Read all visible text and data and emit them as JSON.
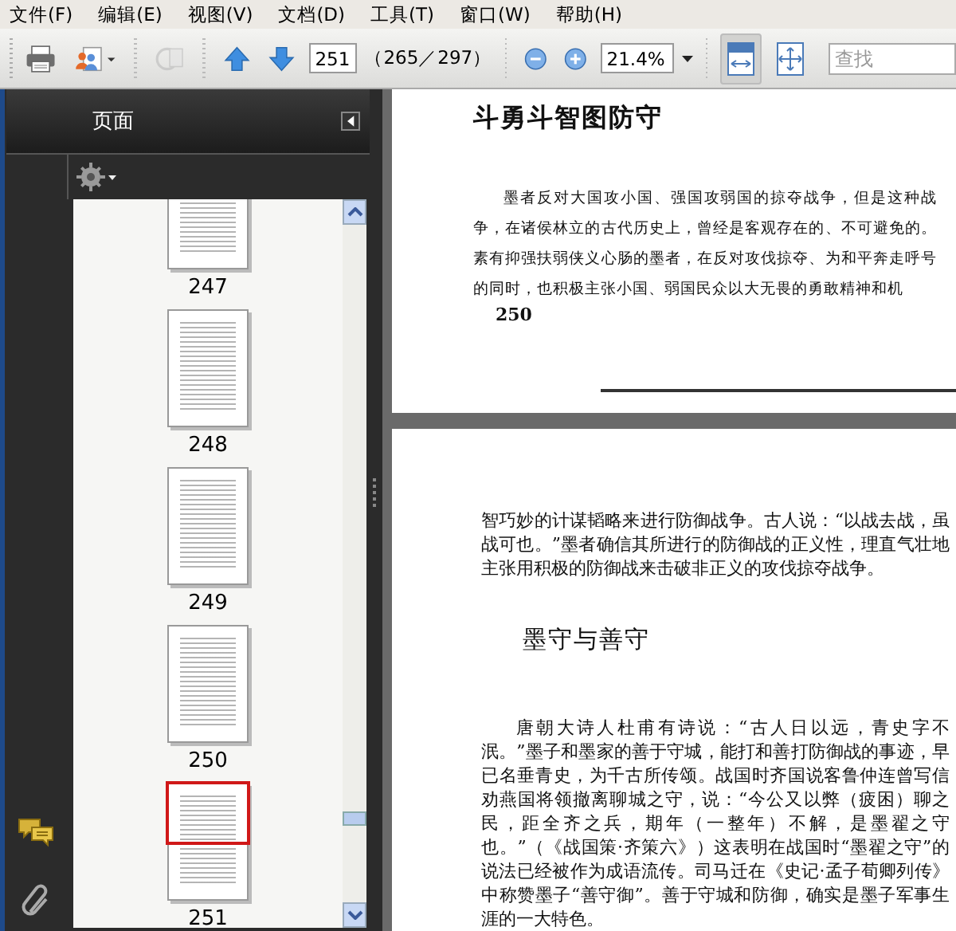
{
  "menu": [
    "文件(F)",
    "编辑(E)",
    "视图(V)",
    "文档(D)",
    "工具(T)",
    "窗口(W)",
    "帮助(H)"
  ],
  "toolbar": {
    "share_disabled": true,
    "page_field": "251",
    "page_count": "（265／297）",
    "zoom": "21.4%",
    "view_modes": [
      {
        "selected": true
      },
      {
        "selected": false
      }
    ],
    "search": {
      "placeholder": "查找"
    }
  },
  "sidebar": {
    "title": "页面",
    "thumbnails": [
      {
        "label": "247",
        "selected": false
      },
      {
        "label": "248",
        "selected": false
      },
      {
        "label": "249",
        "selected": false
      },
      {
        "label": "250",
        "selected": false
      },
      {
        "label": "251",
        "selected": true
      }
    ]
  },
  "document": {
    "pages": [
      {
        "blocks": [
          {
            "kind": "heading",
            "text": "斗勇斗智图防守"
          },
          {
            "kind": "paragraph",
            "indent": true,
            "text": "墨者反对大国攻小国、强国攻弱国的掠夺战争，但是这种战争，在诸侯林立的古代历史上，曾经是客观存在的、不可避免的。素有抑强扶弱侠义心肠的墨者，在反对攻伐掠夺、为和平奔走呼号的同时，也积极主张小国、弱国民众以大无畏的勇敢精神和机"
          },
          {
            "kind": "folio",
            "text": "250"
          }
        ]
      },
      {
        "blocks": [
          {
            "kind": "paragraph",
            "indent": false,
            "text": "智巧妙的计谋韬略来进行防御战争。古人说：“以战去战，虽战可也。”墨者确信其所进行的防御战的正义性，理直气壮地主张用积极的防御战来击破非正义的攻伐掠夺战争。"
          },
          {
            "kind": "heading",
            "text": "墨守与善守"
          },
          {
            "kind": "paragraph",
            "indent": true,
            "text": "唐朝大诗人杜甫有诗说：“古人日以远，青史字不泯。”墨子和墨家的善于守城，能打和善打防御战的事迹，早已名垂青史，为千古所传颂。战国时齐国说客鲁仲连曾写信劝燕国将领撤离聊城之守，说：“今公又以弊（疲困）聊之民，距全齐之兵，期年（一整年）不解，是墨翟之守也。”（《战国策·齐策六》）这表明在战国时“墨翟之守”的说法已经被作为成语流传。司马迁在《史记·孟子荀卿列传》中称赞墨子“善守御”。善于守城和防御，确实是墨子军事生涯的一大特色。"
          }
        ]
      }
    ]
  }
}
